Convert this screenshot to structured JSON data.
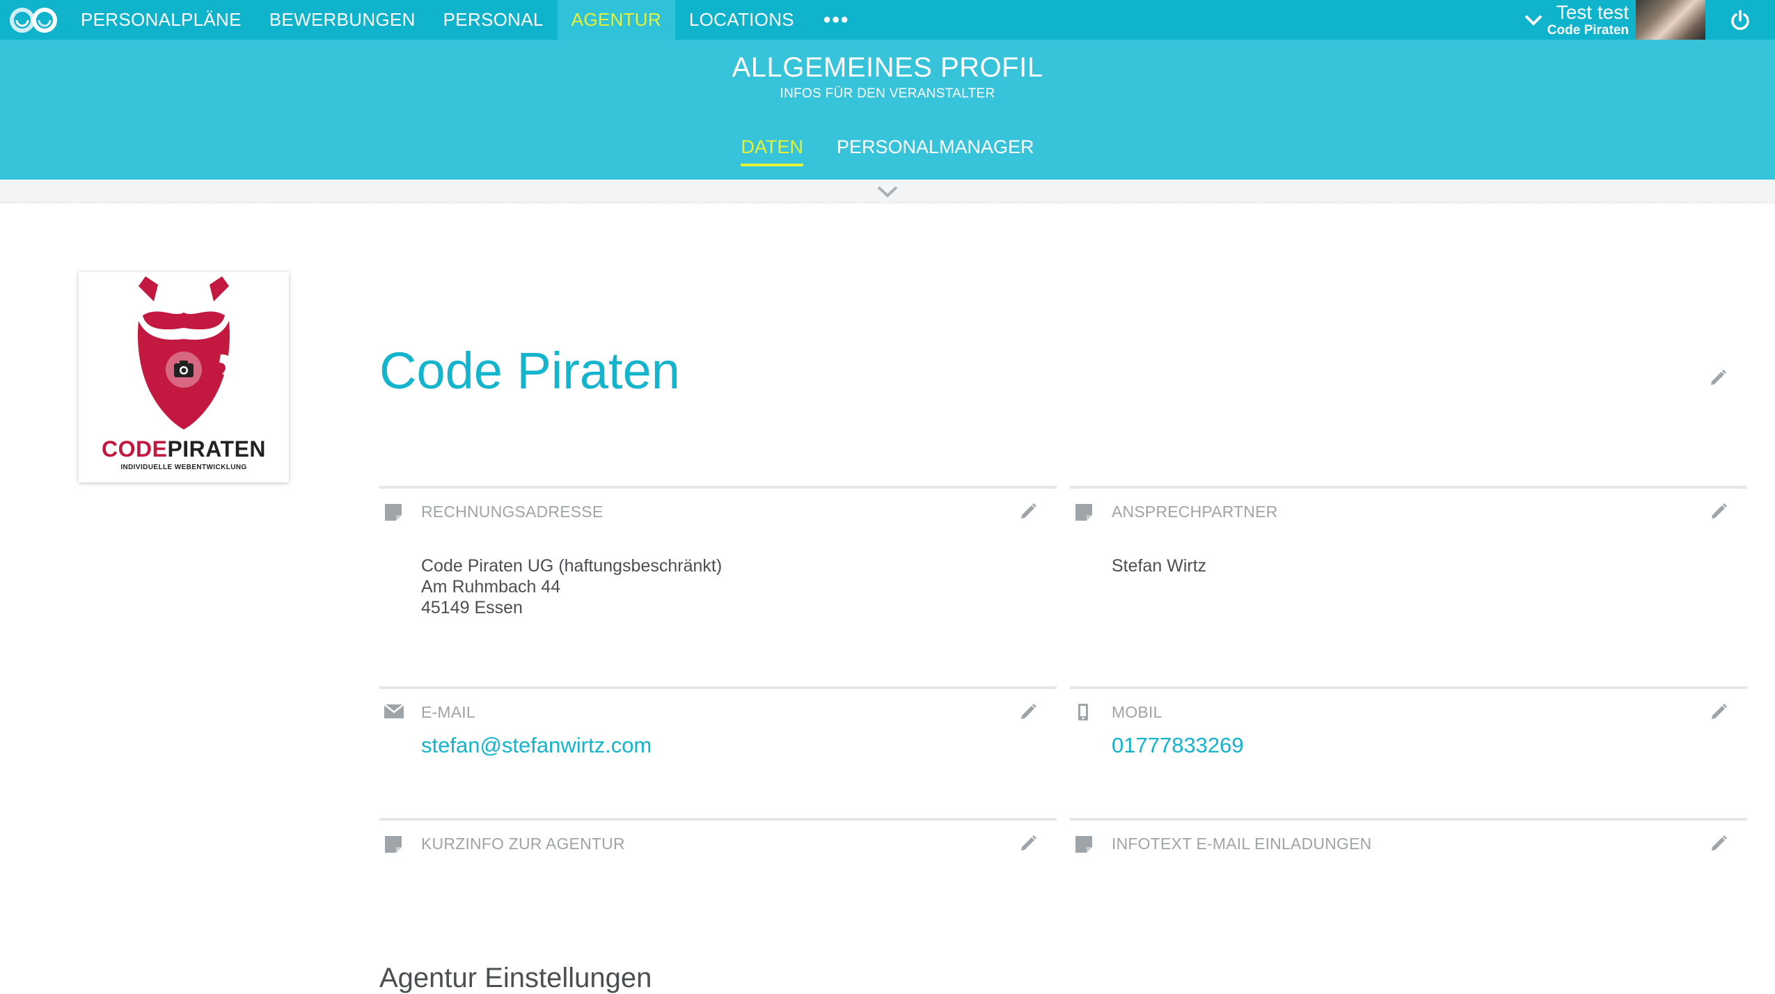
{
  "nav": {
    "items": [
      "PERSONALPLÄNE",
      "BEWERBUNGEN",
      "PERSONAL",
      "AGENTUR",
      "LOCATIONS"
    ],
    "active_index": 3,
    "more": "•••"
  },
  "user": {
    "name": "Test test",
    "company": "Code Piraten"
  },
  "header": {
    "title": "ALLGEMEINES PROFIL",
    "subtitle": "INFOS FÜR DEN VERANSTALTER",
    "tabs": [
      "DATEN",
      "PERSONALMANAGER"
    ],
    "active_tab": 0
  },
  "logo": {
    "word_code": "CODE",
    "word_piraten": "PIRATEN",
    "tagline": "INDIVIDUELLE WEBENTWICKLUNG"
  },
  "profile": {
    "company_name": "Code Piraten"
  },
  "fields": {
    "billing": {
      "label": "RECHNUNGSADRESSE",
      "line1": "Code Piraten UG (haftungsbeschränkt)",
      "line2": "Am Ruhmbach 44",
      "line3": "45149 Essen"
    },
    "contact": {
      "label": "ANSPRECHPARTNER",
      "value": "Stefan Wirtz"
    },
    "email": {
      "label": "E-MAIL",
      "value": "stefan@stefanwirtz.com"
    },
    "mobile": {
      "label": "MOBIL",
      "value": "01777833269"
    },
    "short_info": {
      "label": "KURZINFO ZUR AGENTUR"
    },
    "invite_text": {
      "label": "INFOTEXT E-MAIL EINLADUNGEN"
    }
  },
  "section_heading": "Agentur Einstellungen",
  "colors": {
    "primary": "#0fb3cc",
    "header": "#37c4da",
    "active_nav": "#e6f238",
    "link": "#13b4cc",
    "brand_red": "#c3183f"
  }
}
